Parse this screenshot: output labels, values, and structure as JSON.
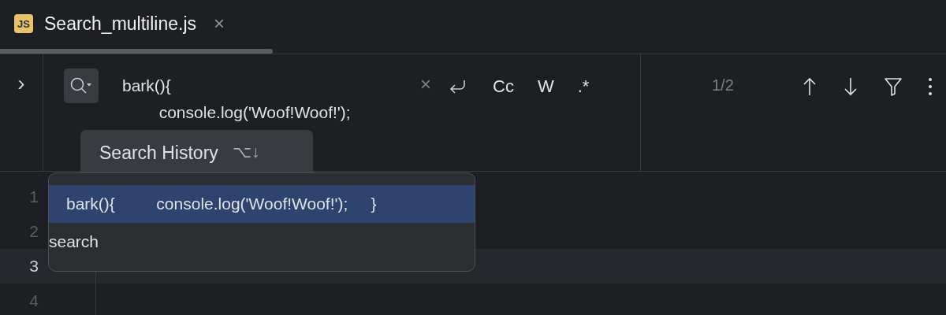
{
  "tab": {
    "icon_text": "JS",
    "title": "Search_multiline.js",
    "close": "×",
    "selected": true
  },
  "find_bar": {
    "expand": "›",
    "query_lines": [
      "bark(){",
      "        console.log('Woof!Woof!');"
    ],
    "clear": "×",
    "options": [
      {
        "label": "Cc",
        "selected": false
      },
      {
        "label": "W",
        "selected": false
      },
      {
        "label": ".*",
        "selected": false
      }
    ],
    "match_count": "1/2"
  },
  "tooltip": {
    "text": "Search History",
    "shortcut": "⌥↓"
  },
  "history": [
    {
      "text": "bark(){         console.log('Woof!Woof!');     }",
      "selected": true
    },
    {
      "text": "search",
      "selected": false
    }
  ],
  "editor": {
    "lines": [
      {
        "number": "1",
        "current": false
      },
      {
        "number": "2",
        "current": false
      },
      {
        "number": "3",
        "current": true
      },
      {
        "number": "4",
        "current": false
      }
    ]
  }
}
